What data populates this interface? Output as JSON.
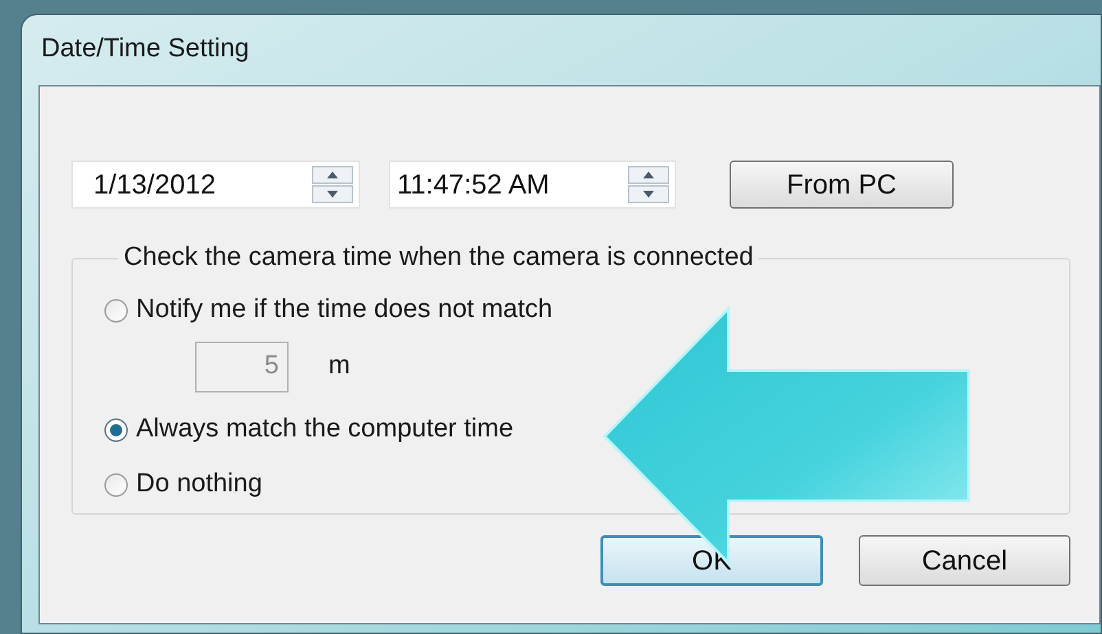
{
  "window": {
    "title": "Date/Time Setting"
  },
  "date_field": {
    "value": "1/13/2012"
  },
  "time_field": {
    "value": "11:47:52 AM"
  },
  "from_pc_button": {
    "label": "From PC"
  },
  "camera_time_group": {
    "title": "Check the camera time when the camera is connected",
    "options": [
      {
        "label": "Notify me if the time does not match",
        "selected": false
      },
      {
        "label": "Always match the computer time",
        "selected": true
      },
      {
        "label": "Do nothing",
        "selected": false
      }
    ],
    "minutes_field": {
      "value": "5",
      "unit": "m",
      "disabled": true
    }
  },
  "buttons": [
    {
      "label": "OK",
      "default": true
    },
    {
      "label": "Cancel",
      "default": false
    }
  ]
}
